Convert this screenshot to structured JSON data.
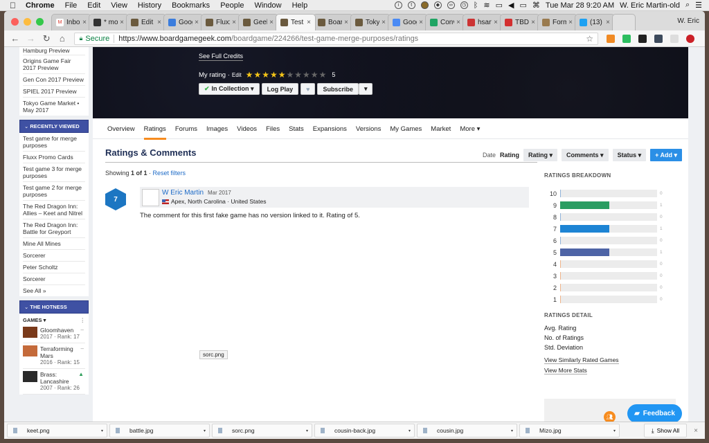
{
  "menubar": {
    "app": "Chrome",
    "items": [
      "File",
      "Edit",
      "View",
      "History",
      "Bookmarks",
      "People",
      "Window",
      "Help"
    ],
    "clock": "Tue Mar 28  9:20 AM",
    "user": "W. Eric Martin-old"
  },
  "tabs": [
    {
      "title": "Inbox",
      "favicon": "gmail-icon",
      "color": "#ffffff",
      "active": false
    },
    {
      "title": "* mo",
      "favicon": "hash-icon",
      "color": "#333333",
      "active": false
    },
    {
      "title": "Edit",
      "favicon": "bgg-icon",
      "color": "#6b5a3e",
      "active": false
    },
    {
      "title": "Goog",
      "favicon": "calendar-icon",
      "color": "#3b7ddd",
      "active": false
    },
    {
      "title": "Fluxx",
      "favicon": "bgg-icon",
      "color": "#6b5a3e",
      "active": false
    },
    {
      "title": "Geek",
      "favicon": "bgg-icon",
      "color": "#6b5a3e",
      "active": false
    },
    {
      "title": "Test",
      "favicon": "bgg-icon",
      "color": "#6b5a3e",
      "active": true
    },
    {
      "title": "Board",
      "favicon": "bgg-icon",
      "color": "#6b5a3e",
      "active": false
    },
    {
      "title": "Tokyo",
      "favicon": "bgg-icon",
      "color": "#6b5a3e",
      "active": false
    },
    {
      "title": "Goog",
      "favicon": "translate-icon",
      "color": "#4a8af4",
      "active": false
    },
    {
      "title": "Conv",
      "favicon": "sheets-icon",
      "color": "#1fa463",
      "active": false
    },
    {
      "title": "hsart",
      "favicon": "hs-icon",
      "color": "#c33",
      "active": false
    },
    {
      "title": "TBD",
      "favicon": "gm-icon",
      "color": "#d32f2f",
      "active": false
    },
    {
      "title": "Form",
      "favicon": "form-icon",
      "color": "#9a7b4f",
      "active": false
    },
    {
      "title": "(13)",
      "favicon": "twitter-icon",
      "color": "#1da1f2",
      "active": false
    }
  ],
  "profile_name": "W. Eric",
  "address": {
    "secure_label": "Secure",
    "host": "https://www.boardgamegeek.com",
    "path": "/boardgame/224266/test-game-merge-purposes/ratings"
  },
  "extensions": [
    {
      "name": "ext-crown-icon",
      "color": "#f08a24"
    },
    {
      "name": "ext-evernote-icon",
      "color": "#2dbe60"
    },
    {
      "name": "ext-buffer-icon",
      "color": "#222222"
    },
    {
      "name": "ext-dots-icon",
      "color": "#3d4a5c"
    },
    {
      "name": "ext-circle-icon",
      "color": "#dddddd"
    },
    {
      "name": "ext-pinterest-icon",
      "color": "#cb2027"
    }
  ],
  "sidebar": {
    "previews": [
      "Hamburg Preview",
      "Origins Game Fair 2017 Preview",
      "Gen Con 2017 Preview",
      "SPIEL 2017 Preview",
      "Tokyo Game Market • May 2017"
    ],
    "recently_viewed_title": "RECENTLY VIEWED",
    "recently_viewed": [
      "Test game for merge purposes",
      "Fluxx Promo Cards",
      "Test game 3 for merge purposes",
      "Test game 2 for merge purposes",
      "The Red Dragon Inn: Allies – Keet and Nitrel",
      "The Red Dragon Inn: Battle for Greyport",
      "Mine All Mines",
      "Sorcerer",
      "Peter Scholtz",
      "Sorcerer",
      "See All »"
    ],
    "hotness_title": "THE HOTNESS",
    "games_label": "GAMES ▾",
    "hot_games": [
      {
        "title": "Gloomhaven",
        "sub": "2017 · Rank: 17",
        "trend": "–",
        "trend_color": "#999999",
        "thumb": "#7a3a1a"
      },
      {
        "title": "Terraforming Mars",
        "sub": "2016 · Rank: 15",
        "trend": "–",
        "trend_color": "#999999",
        "thumb": "#c46a3a"
      },
      {
        "title": "Brass: Lancashire",
        "sub": "2007 · Rank: 26",
        "trend": "▲",
        "trend_color": "#2e9e5a",
        "thumb": "#2a2a2a"
      }
    ]
  },
  "hero": {
    "credits": "See Full Credits",
    "my_rating_label": "My rating ·",
    "edit_label": "Edit",
    "rating_value": "5",
    "rating_fraction": 0.5,
    "buttons": {
      "collection": "In Collection ▾",
      "log_play": "Log Play",
      "subscribe": "Subscribe",
      "more": "▾"
    }
  },
  "subnav": [
    "Overview",
    "Ratings",
    "Forums",
    "Images",
    "Videos",
    "Files",
    "Stats",
    "Expansions",
    "Versions",
    "My Games",
    "Market",
    "More ▾"
  ],
  "subnav_active": "Ratings",
  "ratings": {
    "title": "Ratings & Comments",
    "sort_date": "Date",
    "sort_rating": "Rating",
    "filters": [
      "Rating ▾",
      "Comments ▾",
      "Status ▾"
    ],
    "add_label": "+ Add ▾",
    "showing_prefix": "Showing ",
    "showing_count": "1 of 1",
    "reset_filters": "Reset filters",
    "entries": [
      {
        "rating": "7",
        "user": "W Eric Martin",
        "date": "Mar 2017",
        "location": "Apex, North Carolina · United States",
        "comment": "The comment for this first fake game has no version linked to it. Rating of 5."
      }
    ]
  },
  "tooltip": "sorc.png",
  "breakdown": {
    "title": "RATINGS BREAKDOWN",
    "rows": [
      {
        "rating": 10,
        "count": 0,
        "color": "#8fb3d9"
      },
      {
        "rating": 9,
        "count": 1,
        "color": "#2a9d62"
      },
      {
        "rating": 8,
        "count": 0,
        "color": "#8fb3d9"
      },
      {
        "rating": 7,
        "count": 1,
        "color": "#1d84d4"
      },
      {
        "rating": 6,
        "count": 0,
        "color": "#8fb3d9"
      },
      {
        "rating": 5,
        "count": 1,
        "color": "#4e64a6"
      },
      {
        "rating": 4,
        "count": 0,
        "color": "#f0b48a"
      },
      {
        "rating": 3,
        "count": 0,
        "color": "#f0b48a"
      },
      {
        "rating": 2,
        "count": 0,
        "color": "#f0b48a"
      },
      {
        "rating": 1,
        "count": 0,
        "color": "#f0b48a"
      }
    ],
    "max_fraction": 0.5
  },
  "detail": {
    "title": "RATINGS DETAIL",
    "items": [
      "Avg. Rating",
      "No. of Ratings",
      "Std. Deviation"
    ],
    "links": [
      "View Similarly Rated Games",
      "View More Stats"
    ]
  },
  "feedback_label": "Feedback",
  "downloads": [
    "keet.png",
    "battle.jpg",
    "sorc.png",
    "cousin-back.jpg",
    "cousin.jpg",
    "Mizo.jpg"
  ],
  "show_all": "Show All"
}
